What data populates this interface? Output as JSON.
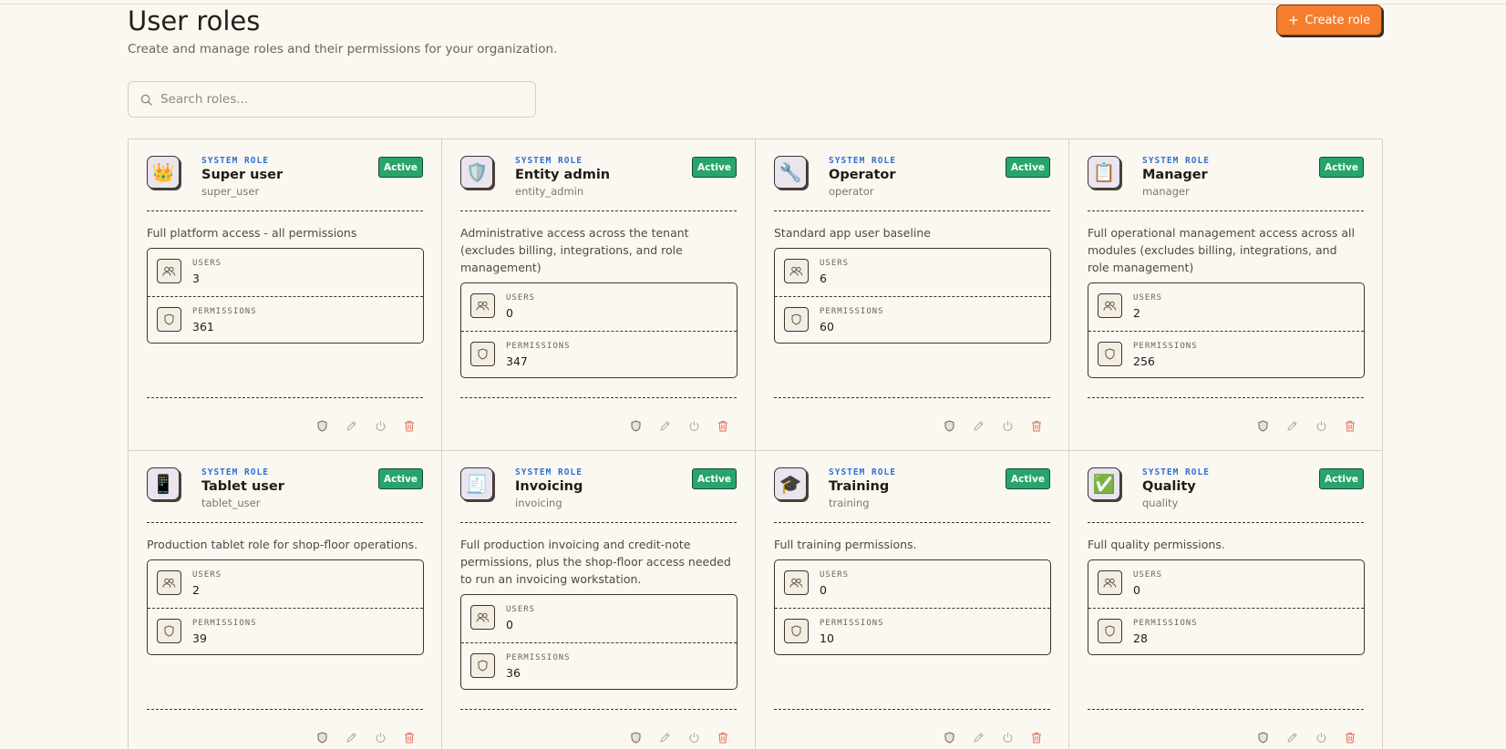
{
  "header": {
    "title": "User roles",
    "subtitle": "Create and manage roles and their permissions for your organization.",
    "create_button": "Create role"
  },
  "search": {
    "placeholder": "Search roles..."
  },
  "labels": {
    "system_role": "SYSTEM ROLE",
    "users": "USERS",
    "permissions": "PERMISSIONS"
  },
  "colors": {
    "accent": "#f57d2d",
    "active_badge": "#27a56a",
    "system_role_label": "#2f6fd6",
    "delete_icon": "#e56a5c"
  },
  "roles": [
    {
      "icon": "crown-icon",
      "glyph": "👑",
      "name": "Super user",
      "key": "super_user",
      "status": "Active",
      "description": "Full platform access - all permissions",
      "users": "3",
      "permissions": "361"
    },
    {
      "icon": "shield-emblem-icon",
      "glyph": "🛡️",
      "name": "Entity admin",
      "key": "entity_admin",
      "status": "Active",
      "description": "Administrative access across the tenant (excludes billing, integrations, and role management)",
      "users": "0",
      "permissions": "347"
    },
    {
      "icon": "wrench-icon",
      "glyph": "🔧",
      "name": "Operator",
      "key": "operator",
      "status": "Active",
      "description": "Standard app user baseline",
      "users": "6",
      "permissions": "60"
    },
    {
      "icon": "clipboard-icon",
      "glyph": "📋",
      "name": "Manager",
      "key": "manager",
      "status": "Active",
      "description": "Full operational management access across all modules (excludes billing, integrations, and role management)",
      "users": "2",
      "permissions": "256"
    },
    {
      "icon": "tablet-icon",
      "glyph": "📱",
      "name": "Tablet user",
      "key": "tablet_user",
      "status": "Active",
      "description": "Production tablet role for shop-floor operations.",
      "users": "2",
      "permissions": "39"
    },
    {
      "icon": "invoice-icon",
      "glyph": "🧾",
      "name": "Invoicing",
      "key": "invoicing",
      "status": "Active",
      "description": "Full production invoicing and credit-note permissions, plus the shop-floor access needed to run an invoicing workstation.",
      "users": "0",
      "permissions": "36"
    },
    {
      "icon": "graduation-cap-icon",
      "glyph": "🎓",
      "name": "Training",
      "key": "training",
      "status": "Active",
      "description": "Full training permissions.",
      "users": "0",
      "permissions": "10"
    },
    {
      "icon": "check-mark-icon",
      "glyph": "✅",
      "name": "Quality",
      "key": "quality",
      "status": "Active",
      "description": "Full quality permissions.",
      "users": "0",
      "permissions": "28"
    }
  ]
}
